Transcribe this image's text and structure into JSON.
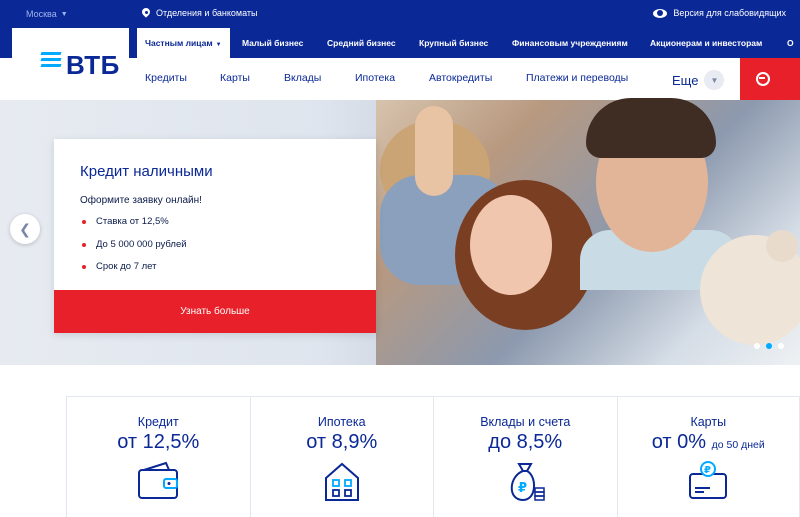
{
  "topbar": {
    "city": "Москва",
    "branches": "Отделения и банкоматы",
    "accessibility": "Версия для слабовидящих"
  },
  "segments": [
    {
      "label": "Частным лицам",
      "active": true
    },
    {
      "label": "Малый бизнес"
    },
    {
      "label": "Средний бизнес"
    },
    {
      "label": "Крупный бизнес"
    },
    {
      "label": "Финансовым учреждениям"
    },
    {
      "label": "Акционерам и инвесторам"
    },
    {
      "label": "О"
    }
  ],
  "logo": {
    "text": "ВТБ"
  },
  "nav": {
    "items": [
      "Кредиты",
      "Карты",
      "Вклады",
      "Ипотека",
      "Автокредиты",
      "Платежи и переводы"
    ],
    "more": "Еще"
  },
  "hero": {
    "card_title": "Кредит наличными",
    "card_subtitle": "Оформите заявку онлайн!",
    "bullets": [
      "Ставка от 12,5%",
      "До 5 000 000 рублей",
      "Срок до 7 лет"
    ],
    "cta": "Узнать больше",
    "slide_count": 3,
    "active_slide": 2
  },
  "products": [
    {
      "name": "Кредит",
      "rate": "от 12,5%",
      "icon": "wallet-icon"
    },
    {
      "name": "Ипотека",
      "rate": "от 8,9%",
      "icon": "house-icon"
    },
    {
      "name": "Вклады и счета",
      "rate": "до 8,5%",
      "icon": "money-bag-icon"
    },
    {
      "name": "Карты",
      "rate": "от 0%",
      "rate_suffix": "до 50 дней",
      "icon": "card-icon"
    }
  ],
  "colors": {
    "brand_blue": "#0a2896",
    "accent_red": "#e8202a",
    "logo_cyan": "#00aaff"
  }
}
